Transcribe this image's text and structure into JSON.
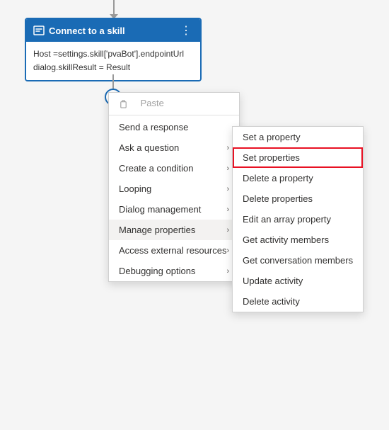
{
  "canvas": {
    "background": "#f5f5f5"
  },
  "skillNode": {
    "title": "Connect to a skill",
    "line1": "Host =settings.skill['pvaBot'].endpointUrl",
    "line2": "dialog.skillResult = Result",
    "menuIcon": "⋮"
  },
  "contextMenu": {
    "items": [
      {
        "id": "paste",
        "label": "Paste",
        "hasIcon": true,
        "hasSubmenu": false,
        "disabled": false
      },
      {
        "id": "separator1",
        "type": "separator"
      },
      {
        "id": "send-response",
        "label": "Send a response",
        "hasSubmenu": false,
        "disabled": false
      },
      {
        "id": "ask-question",
        "label": "Ask a question",
        "hasSubmenu": true,
        "disabled": false
      },
      {
        "id": "create-condition",
        "label": "Create a condition",
        "hasSubmenu": true,
        "disabled": false
      },
      {
        "id": "looping",
        "label": "Looping",
        "hasSubmenu": true,
        "disabled": false
      },
      {
        "id": "dialog-management",
        "label": "Dialog management",
        "hasSubmenu": true,
        "disabled": false
      },
      {
        "id": "manage-properties",
        "label": "Manage properties",
        "hasSubmenu": true,
        "disabled": false,
        "active": true
      },
      {
        "id": "access-external",
        "label": "Access external resources",
        "hasSubmenu": true,
        "disabled": false
      },
      {
        "id": "debugging",
        "label": "Debugging options",
        "hasSubmenu": true,
        "disabled": false
      }
    ]
  },
  "submenu": {
    "items": [
      {
        "id": "set-property",
        "label": "Set a property",
        "highlighted": false
      },
      {
        "id": "set-properties",
        "label": "Set properties",
        "highlighted": true
      },
      {
        "id": "delete-property",
        "label": "Delete a property",
        "highlighted": false
      },
      {
        "id": "delete-properties",
        "label": "Delete properties",
        "highlighted": false
      },
      {
        "id": "edit-array",
        "label": "Edit an array property",
        "highlighted": false
      },
      {
        "id": "get-activity-members",
        "label": "Get activity members",
        "highlighted": false
      },
      {
        "id": "get-conversation-members",
        "label": "Get conversation members",
        "highlighted": false
      },
      {
        "id": "update-activity",
        "label": "Update activity",
        "highlighted": false
      },
      {
        "id": "delete-activity",
        "label": "Delete activity",
        "highlighted": false
      }
    ]
  }
}
